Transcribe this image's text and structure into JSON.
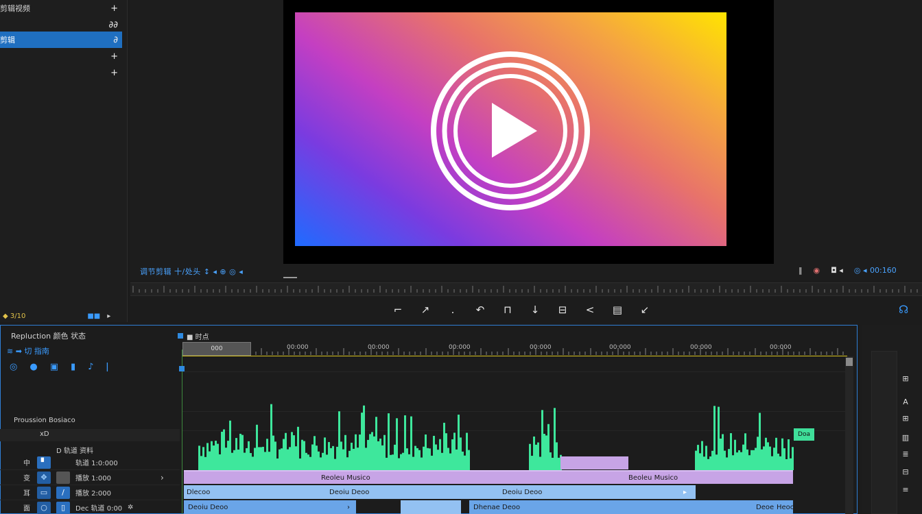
{
  "project_panel": {
    "rows": [
      {
        "label": "剪辑视频",
        "icon": "+"
      },
      {
        "label": "",
        "icon": "∂∂"
      },
      {
        "label": "剪辑",
        "icon": "∂",
        "selected": true
      },
      {
        "label": "",
        "icon": "+"
      },
      {
        "label": "",
        "icon": "+"
      }
    ],
    "bin_strip": {
      "left": "◆ 3/10",
      "middle": "■■",
      "right": "▸"
    }
  },
  "monitor": {
    "timecode_left": "调节剪辑 十/处头 ↕ ◂ ⊕ ◎ ◂",
    "timecode_right": "00:160",
    "right_icons": [
      "‖",
      "◉",
      "◘ ◂",
      "◎ ◂"
    ],
    "transport": [
      "⌐",
      "↗",
      ".",
      "↶",
      "⊓",
      "↓",
      "⊟",
      "<",
      "▤",
      "↙"
    ]
  },
  "timeline": {
    "title": "Repluction 颜色 状态",
    "tools_row1": "≋ ➡ 切 指南",
    "tools_row2": [
      "◎",
      "●",
      "▣",
      "▮",
      "♪",
      "ǀ"
    ],
    "ruler_marker": "■ 时点",
    "in_range_label": "000",
    "ruler_labels": [
      "00:000",
      "00:000",
      "00:000",
      "00:000",
      "00:000",
      "00:000",
      "00:000",
      "00:000"
    ],
    "section_label": "Proussion Bosiaco",
    "sub_label": "xD",
    "tracks_header": "D 轨道 资料",
    "tracks": [
      {
        "name": "中",
        "value": "轨道 1:0:000"
      },
      {
        "name": "变",
        "value": "播放 1:000"
      },
      {
        "name": "耳",
        "value": "播放 2:000"
      },
      {
        "name": "面",
        "value": "Dec 轨道 0:00"
      }
    ],
    "clips": {
      "purple_left": "Reoleu Musico",
      "purple_right": "Beoleu Musico",
      "blue1_a": "Dlecoo",
      "blue1_b": "Deoiu Deoo",
      "blue1_c": "Deoiu Deoo",
      "blue2_a": "Deoiu Deoo",
      "blue2_b": "Dhenae Deoo",
      "blue2_c": "Deoe",
      "blue2_d": "Heoo"
    },
    "audio_clip_tag": "Doa"
  },
  "right_rail": {
    "icons": [
      "⊞",
      "A",
      "⊞",
      "▥",
      "≣",
      "⊟",
      "≡"
    ]
  }
}
